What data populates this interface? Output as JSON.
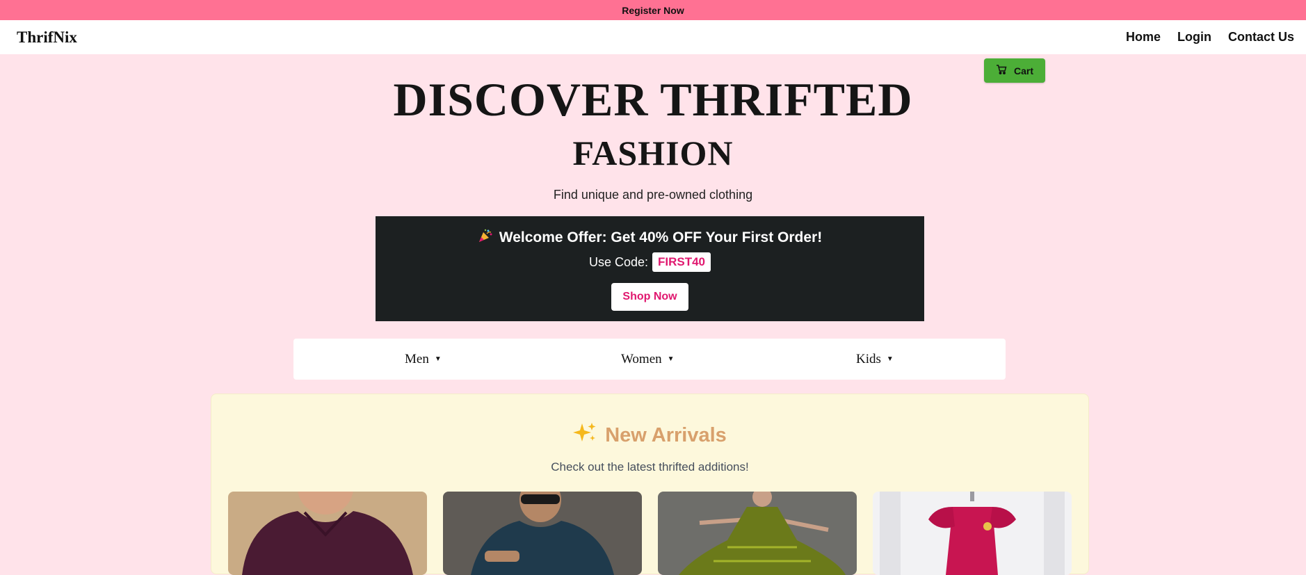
{
  "topbar": {
    "register_label": "Register Now"
  },
  "navbar": {
    "brand": "ThrifNix",
    "links": [
      "Home",
      "Login",
      "Contact Us"
    ]
  },
  "cart": {
    "label": "Cart",
    "icon": "cart-icon",
    "color": "#4cae37"
  },
  "hero": {
    "title": "DISCOVER THRIFTED",
    "subtitle": "FASHION",
    "tagline": "Find unique and pre-owned clothing"
  },
  "offer": {
    "icon": "party-popper-icon",
    "title": "Welcome Offer: Get 40% OFF Your First Order!",
    "code_label": "Use Code:",
    "code": "FIRST40",
    "shop_label": "Shop Now",
    "accent": "#e0186f"
  },
  "categories": [
    {
      "label": "Men",
      "caret": "▼"
    },
    {
      "label": "Women",
      "caret": "▼"
    },
    {
      "label": "Kids",
      "caret": "▼"
    }
  ],
  "arrivals": {
    "icon": "sparkles-icon",
    "title": "New Arrivals",
    "subtitle": "Check out the latest thrifted additions!",
    "products": [
      {
        "name": "product-image-men-polo"
      },
      {
        "name": "product-image-men-shirt"
      },
      {
        "name": "product-image-women-dress"
      },
      {
        "name": "product-image-kids-dress"
      }
    ]
  },
  "colors": {
    "topbar": "#ff7193",
    "page_bg": "#ffe3ea",
    "offer_bg": "#1c2021",
    "arrivals_bg": "#fdf8dc",
    "arrivals_title": "#d8a06c"
  }
}
